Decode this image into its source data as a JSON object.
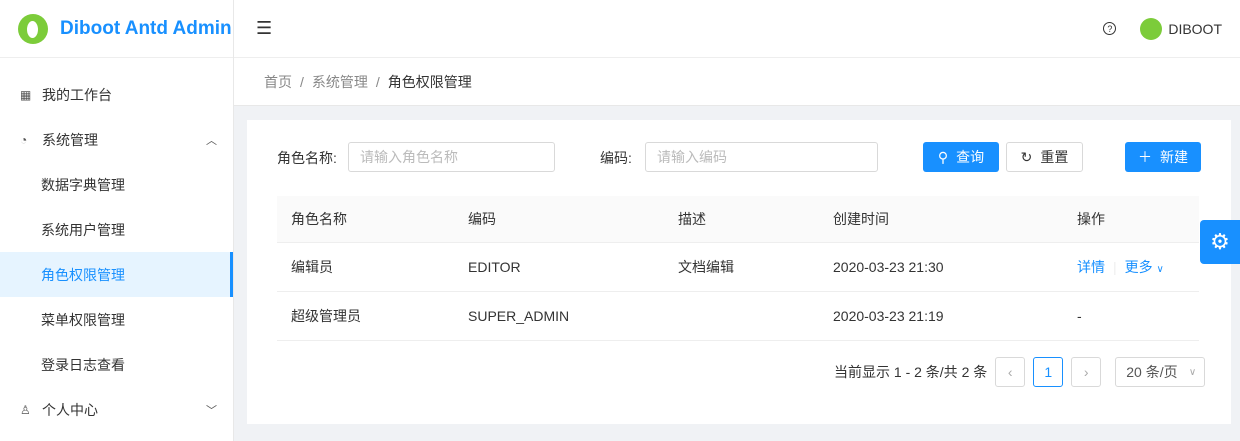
{
  "app": {
    "title": "Diboot Antd Admin",
    "user": "DIBOOT"
  },
  "sidebar": {
    "items": [
      {
        "label": "我的工作台",
        "icon": "▦"
      },
      {
        "label": "系统管理",
        "icon": "◔"
      },
      {
        "label": "数据字典管理"
      },
      {
        "label": "系统用户管理"
      },
      {
        "label": "角色权限管理"
      },
      {
        "label": "菜单权限管理"
      },
      {
        "label": "登录日志查看"
      },
      {
        "label": "个人中心",
        "icon": "♙"
      }
    ]
  },
  "breadcrumb": [
    "首页",
    "系统管理",
    "角色权限管理"
  ],
  "search": {
    "name_label": "角色名称:",
    "name_placeholder": "请输入角色名称",
    "code_label": "编码:",
    "code_placeholder": "请输入编码",
    "query": "查询",
    "reset": "重置",
    "create": "新建"
  },
  "table": {
    "headers": [
      "角色名称",
      "编码",
      "描述",
      "创建时间",
      "操作"
    ],
    "rows": [
      {
        "name": "编辑员",
        "code": "EDITOR",
        "desc": "文档编辑",
        "created": "2020-03-23 21:30",
        "detail": "详情",
        "more": "更多"
      },
      {
        "name": "超级管理员",
        "code": "SUPER_ADMIN",
        "desc": "",
        "created": "2020-03-23 21:19",
        "action": "-"
      }
    ]
  },
  "pagination": {
    "summary": "当前显示 1 - 2 条/共 2 条",
    "current": "1",
    "page_size": "20 条/页"
  }
}
